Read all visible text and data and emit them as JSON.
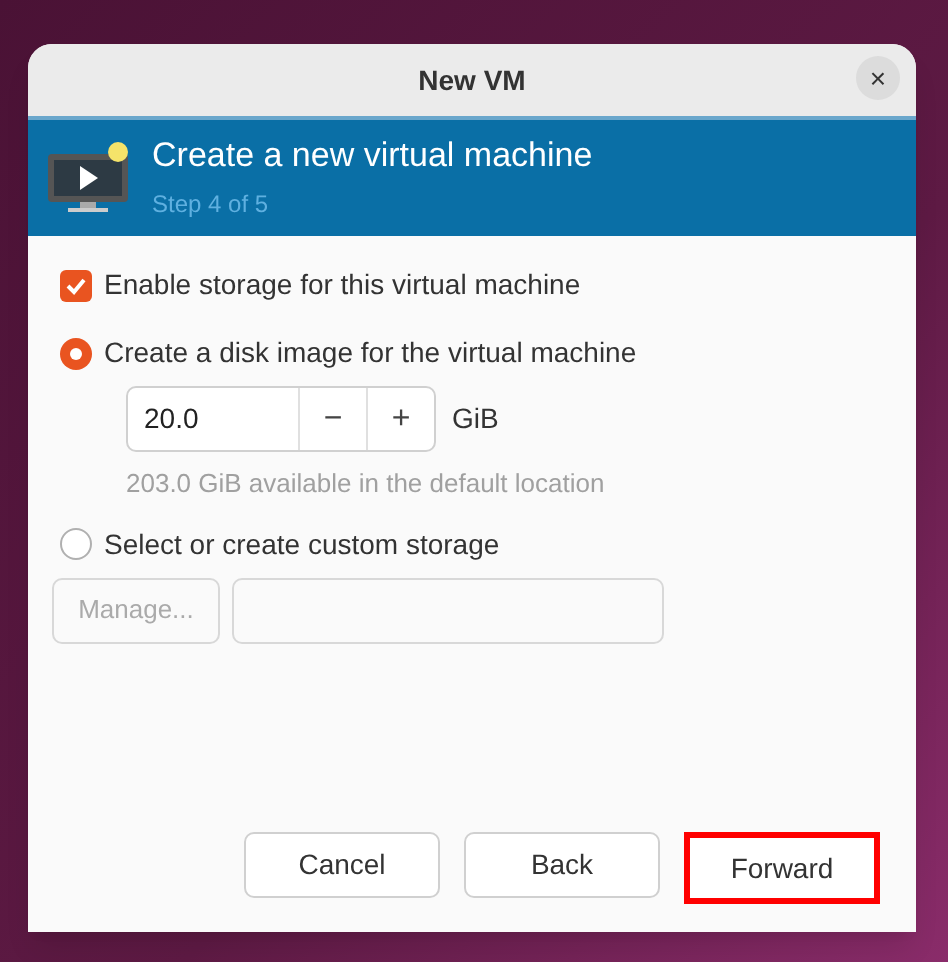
{
  "window": {
    "title": "New VM",
    "close": "×"
  },
  "header": {
    "title": "Create a new virtual machine",
    "subtitle": "Step 4 of 5"
  },
  "enable_storage": {
    "label": "Enable storage for this virtual machine",
    "checked": true
  },
  "options": [
    {
      "kind": "disk",
      "label": "Create a disk image for the virtual machine",
      "selected": true
    },
    {
      "kind": "custom",
      "label": "Select or create custom storage",
      "selected": false
    }
  ],
  "disk": {
    "value": "20.0",
    "minus": "−",
    "plus": "+",
    "unit": "GiB",
    "note": "203.0 GiB available in the default location"
  },
  "custom": {
    "manage": "Manage...",
    "disabled": true
  },
  "buttons": [
    {
      "label": "Cancel",
      "highlighted": false
    },
    {
      "label": "Back",
      "highlighted": false
    },
    {
      "label": "Forward",
      "highlighted": true
    }
  ]
}
